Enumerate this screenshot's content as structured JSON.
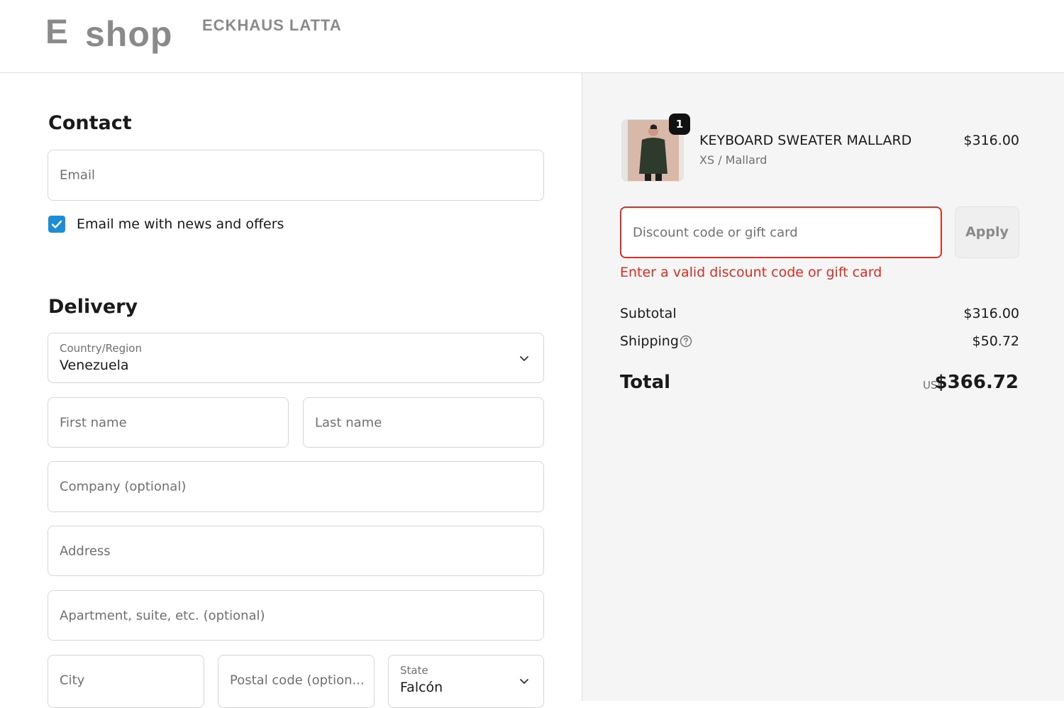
{
  "header": {
    "logo_letter": "E",
    "logo_word": "shop",
    "brand": "ECKHAUS LATTA"
  },
  "contact": {
    "heading": "Contact",
    "email_placeholder": "Email",
    "newsletter_label": "Email me with news and offers",
    "newsletter_checked": true
  },
  "delivery": {
    "heading": "Delivery",
    "country_label": "Country/Region",
    "country_value": "Venezuela",
    "first_name_placeholder": "First name",
    "last_name_placeholder": "Last name",
    "company_placeholder": "Company (optional)",
    "address_placeholder": "Address",
    "apartment_placeholder": "Apartment, suite, etc. (optional)",
    "city_placeholder": "City",
    "postal_placeholder": "Postal code (option...",
    "state_label": "State",
    "state_value": "Falcón"
  },
  "summary": {
    "item": {
      "quantity": "1",
      "name": "KEYBOARD SWEATER MALLARD",
      "variant": "XS / Mallard",
      "price": "$316.00"
    },
    "discount_placeholder": "Discount code or gift card",
    "apply_label": "Apply",
    "error_message": "Enter a valid discount code or gift card",
    "subtotal_label": "Subtotal",
    "subtotal_value": "$316.00",
    "shipping_label": "Shipping",
    "shipping_value": "$50.72",
    "total_label": "Total",
    "currency": "USD",
    "total_value": "$366.72"
  },
  "colors": {
    "accent": "#1f8dd6",
    "error": "#d93025",
    "summary_bg": "#f5f5f5"
  }
}
